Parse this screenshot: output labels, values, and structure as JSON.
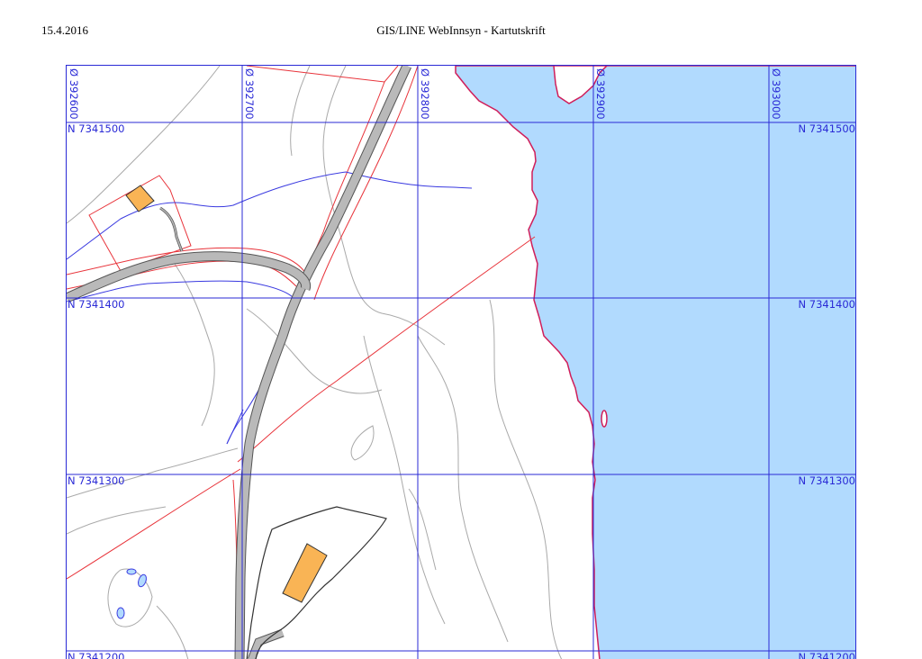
{
  "header": {
    "date": "15.4.2016",
    "title": "GIS/LINE WebInnsyn - Kartutskrift"
  },
  "map": {
    "water_color": "#b1dafe",
    "grid_color": "#2a2ad6",
    "shoreline_color": "#d01e5a",
    "boundary_color": "#e8333a",
    "contour_color": "#a9a9a9",
    "road_color": "#b9b9b9",
    "building_color": "#f9b455",
    "easting_labels": [
      "Ø 392600",
      "Ø 392700",
      "Ø 392800",
      "Ø 392900",
      "Ø 393000"
    ],
    "northing_labels": [
      "N 7341500",
      "N 7341400",
      "N 7341300",
      "N 7341200"
    ],
    "icons": {
      "grid": "coordinate-grid",
      "water": "water-area",
      "building": "building-footprint",
      "road": "road"
    }
  }
}
